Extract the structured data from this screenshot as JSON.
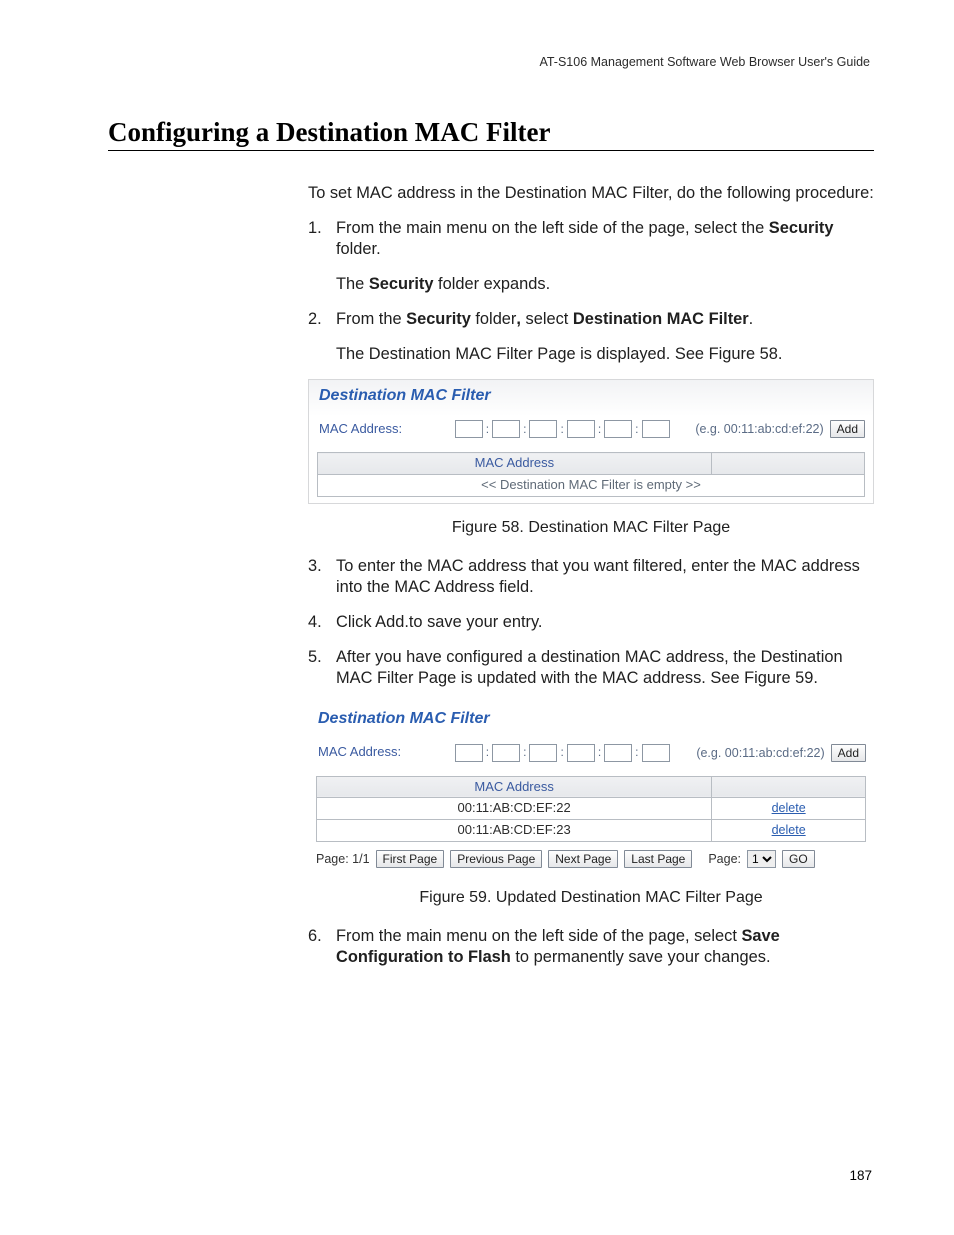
{
  "header": {
    "running_head": "AT-S106 Management Software Web Browser User's Guide"
  },
  "section": {
    "title": "Configuring a Destination MAC Filter"
  },
  "intro": "To set MAC address in the Destination MAC Filter, do the following procedure:",
  "steps": {
    "s1": {
      "num": "1.",
      "pre": "From the main menu on the left side of the page, select the ",
      "bold1": "Security",
      "post": " folder.",
      "line2_pre": "The ",
      "line2_bold": "Security",
      "line2_post": " folder expands."
    },
    "s2": {
      "num": "2.",
      "pre": "From the ",
      "bold1": "Security",
      "mid": " folder",
      "comma": ",",
      "sel": " select ",
      "bold2": "Destination MAC Filter",
      "post": ".",
      "line2": "The Destination MAC Filter Page is displayed. See Figure 58."
    },
    "s3": {
      "num": "3.",
      "text": "To enter the MAC address that you want filtered, enter the MAC address into the MAC Address field."
    },
    "s4": {
      "num": "4.",
      "text": "Click Add.to save your entry."
    },
    "s5": {
      "num": "5.",
      "text": "After you have configured a destination MAC address, the Destination MAC Filter Page is updated with the MAC address. See Figure 59."
    },
    "s6": {
      "num": "6.",
      "pre": "From the main menu on the left side of the page, select ",
      "bold1": "Save Configuration to Flash",
      "post": " to permanently save your changes."
    }
  },
  "captions": {
    "c58": "Figure 58. Destination MAC Filter Page",
    "c59": "Figure 59. Updated Destination MAC Filter Page"
  },
  "shot_common": {
    "title": "Destination MAC Filter",
    "mac_label": "MAC Address:",
    "example": "(e.g. 00:11:ab:cd:ef:22)",
    "add": "Add",
    "th_mac": "MAC Address"
  },
  "shot58": {
    "empty": "<< Destination MAC Filter is empty >>"
  },
  "shot59": {
    "rows": [
      {
        "mac": "00:11:AB:CD:EF:22",
        "action": "delete"
      },
      {
        "mac": "00:11:AB:CD:EF:23",
        "action": "delete"
      }
    ],
    "pager": {
      "label": "Page: 1/1",
      "first": "First Page",
      "prev": "Previous Page",
      "next": "Next Page",
      "last": "Last Page",
      "page_label": "Page:",
      "select": "1",
      "go": "GO"
    }
  },
  "page_number": "187"
}
